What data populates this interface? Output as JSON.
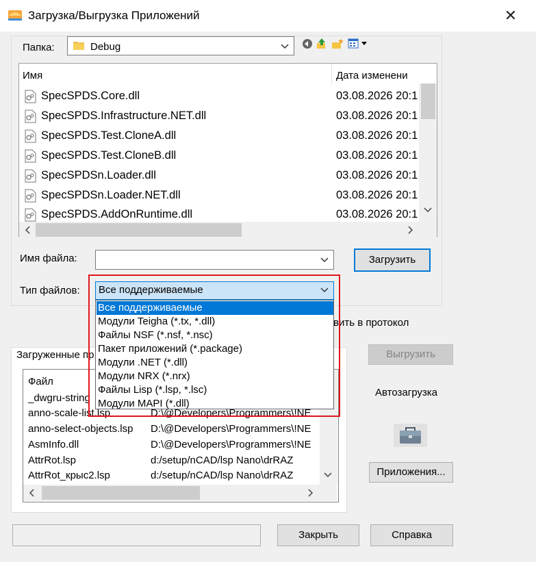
{
  "window": {
    "title": "Загрузка/Выгрузка Приложений",
    "close_glyph": "✕"
  },
  "folder": {
    "label": "Папка:",
    "value": "Debug"
  },
  "toolbar_icons": [
    "back-icon",
    "up-folder-icon",
    "new-folder-icon",
    "view-menu-icon"
  ],
  "file_list": {
    "col_name": "Имя",
    "col_date": "Дата изменени",
    "rows": [
      {
        "name": "SpecSPDS.Core.dll",
        "date": "03.08.2026 20:1"
      },
      {
        "name": "SpecSPDS.Infrastructure.NET.dll",
        "date": "03.08.2026 20:1"
      },
      {
        "name": "SpecSPDS.Test.CloneA.dll",
        "date": "03.08.2026 20:1"
      },
      {
        "name": "SpecSPDS.Test.CloneB.dll",
        "date": "03.08.2026 20:1"
      },
      {
        "name": "SpecSPDSn.Loader.dll",
        "date": "03.08.2026 20:1"
      },
      {
        "name": "SpecSPDSn.Loader.NET.dll",
        "date": "03.08.2026 20:1"
      },
      {
        "name": "SpecSPDS.AddOnRuntime.dll",
        "date": "03.08.2026 20:1"
      }
    ]
  },
  "filename": {
    "label": "Имя файла:",
    "value": ""
  },
  "load_button": "Загрузить",
  "filetype": {
    "label": "Тип файлов:",
    "value": "Все поддерживаемые",
    "options": [
      "Все поддерживаемые",
      "Модули Teigha (*.tx, *.dll)",
      "Файлы NSF (*.nsf, *.nsc)",
      "Пакет приложений (*.package)",
      "Модули .NET (*.dll)",
      "Модули NRX (*.nrx)",
      "Файлы Lisp (*.lsp, *.lsc)",
      "Модули MAPI (*.dll)"
    ]
  },
  "history_text": "вить в протокол",
  "loaded": {
    "tab_label": "Загруженные пр",
    "col_file": "Файл",
    "rows": [
      {
        "name": "_dwgru-string",
        "path": ""
      },
      {
        "name": "anno-scale-list.lsp",
        "path": "D:\\@Developers\\Programmers\\!NE"
      },
      {
        "name": "anno-select-objects.lsp",
        "path": "D:\\@Developers\\Programmers\\!NE"
      },
      {
        "name": "AsmInfo.dll",
        "path": "D:\\@Developers\\Programmers\\!NE"
      },
      {
        "name": "AttrRot.lsp",
        "path": "d:/setup/nCAD/lsp Nano\\drRAZ"
      },
      {
        "name": "AttrRot_крыс2.lsp",
        "path": "d:/setup/nCAD/lsp Nano\\drRAZ"
      }
    ]
  },
  "unload_button": "Выгрузить",
  "autoload_label": "Автозагрузка",
  "apps_button": "Приложения...",
  "close_button": "Закрыть",
  "help_button": "Справка",
  "colors": {
    "highlight": "#e0161d",
    "selection": "#0078d7",
    "combo_focus": "#cce4f7"
  }
}
